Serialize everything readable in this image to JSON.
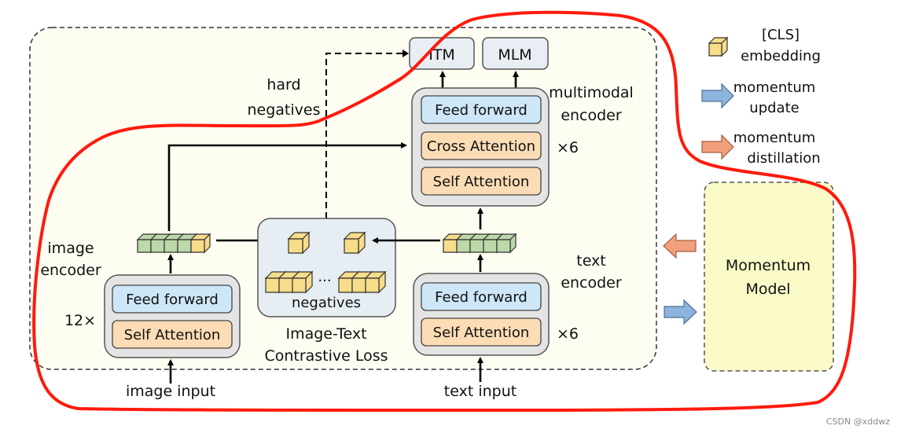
{
  "diagram": {
    "outputs": {
      "itm": "ITM",
      "mlm": "MLM"
    },
    "hard_negatives": [
      "hard",
      "negatives"
    ],
    "multimodal_encoder": {
      "label": [
        "multimodal",
        "encoder"
      ],
      "layers": [
        "Feed forward",
        "Cross Attention",
        "Self Attention"
      ],
      "repeat": "×6"
    },
    "image_encoder": {
      "label": [
        "image",
        "encoder"
      ],
      "layers": [
        "Feed forward",
        "Self Attention"
      ],
      "repeat": "12×",
      "input": "image input"
    },
    "text_encoder": {
      "label": [
        "text",
        "encoder"
      ],
      "layers": [
        "Feed forward",
        "Self Attention"
      ],
      "repeat": "×6",
      "input": "text input"
    },
    "contrastive": {
      "ellipsis": "...",
      "negatives": "negatives",
      "label": [
        "Image-Text",
        "Contrastive Loss"
      ]
    },
    "legend": {
      "cls": [
        "[CLS]",
        "embedding"
      ],
      "momentum_update": [
        "momentum",
        "update"
      ],
      "momentum_distillation": [
        "momentum",
        "distillation"
      ]
    },
    "momentum_model": [
      "Momentum",
      "Model"
    ],
    "watermark": "CSDN @xddwz"
  },
  "colors": {
    "feed_forward": "#cde7f8",
    "attention": "#fbdcb5",
    "cls_token": "#f7dc8a",
    "patch_token": "#bcd9a8",
    "momentum_update_arrow": "#8db4dc",
    "momentum_distillation_arrow": "#f2a07c",
    "momentum_model": "#fafac8",
    "annotation": "#ff1a0d"
  }
}
